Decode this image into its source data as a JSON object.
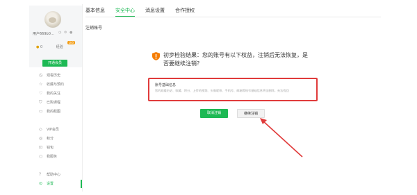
{
  "profile": {
    "username": "用户669b0...",
    "coin_label": "0",
    "coin_symbol": "●",
    "badge_label": "经验",
    "level": "LV0",
    "vip_button_label": "开通会员"
  },
  "sidebar": {
    "items": [
      {
        "icon": "◷",
        "label": "观看历史",
        "icon_name": "history-icon"
      },
      {
        "icon": "☆",
        "label": "收藏与预约",
        "icon_name": "star-icon"
      },
      {
        "icon": "♡",
        "label": "我的关注",
        "icon_name": "heart-icon"
      },
      {
        "icon": "⛉",
        "label": "已购课程",
        "icon_name": "course-icon"
      },
      {
        "icon": "▭",
        "label": "我的截图",
        "icon_name": "screenshot-icon"
      },
      {
        "icon": "◇",
        "label": "VIP会员",
        "icon_name": "vip-icon"
      },
      {
        "icon": "◎",
        "label": "积分",
        "icon_name": "points-icon"
      },
      {
        "icon": "⊡",
        "label": "钱包",
        "icon_name": "wallet-icon"
      },
      {
        "icon": "○",
        "label": "我服务",
        "icon_name": "service-icon"
      },
      {
        "icon": "?",
        "label": "帮助中心",
        "icon_name": "help-icon"
      },
      {
        "icon": "⊙",
        "label": "设置",
        "icon_name": "settings-icon"
      }
    ],
    "active_label": "设置"
  },
  "tabs": [
    {
      "label": "基本信息"
    },
    {
      "label": "安全中心"
    },
    {
      "label": "消息设置"
    },
    {
      "label": "合作授权"
    }
  ],
  "main": {
    "section_title": "注销账号",
    "result_text": "初步检验结果：您的账号有以下权益，注销后无法恢复，是否要继续注销？",
    "info_title": "账号基础信息",
    "info_desc": "您的观看历史、收藏、积分、上传的视频、头像昵称、手机号、邮箱等账号基础信息将全删除，无法找回",
    "cancel_button": "取消注销",
    "continue_button": "继续注销"
  },
  "colors": {
    "accent": "#1db954",
    "highlight": "#e03b3b",
    "warning": "#f57c00"
  }
}
